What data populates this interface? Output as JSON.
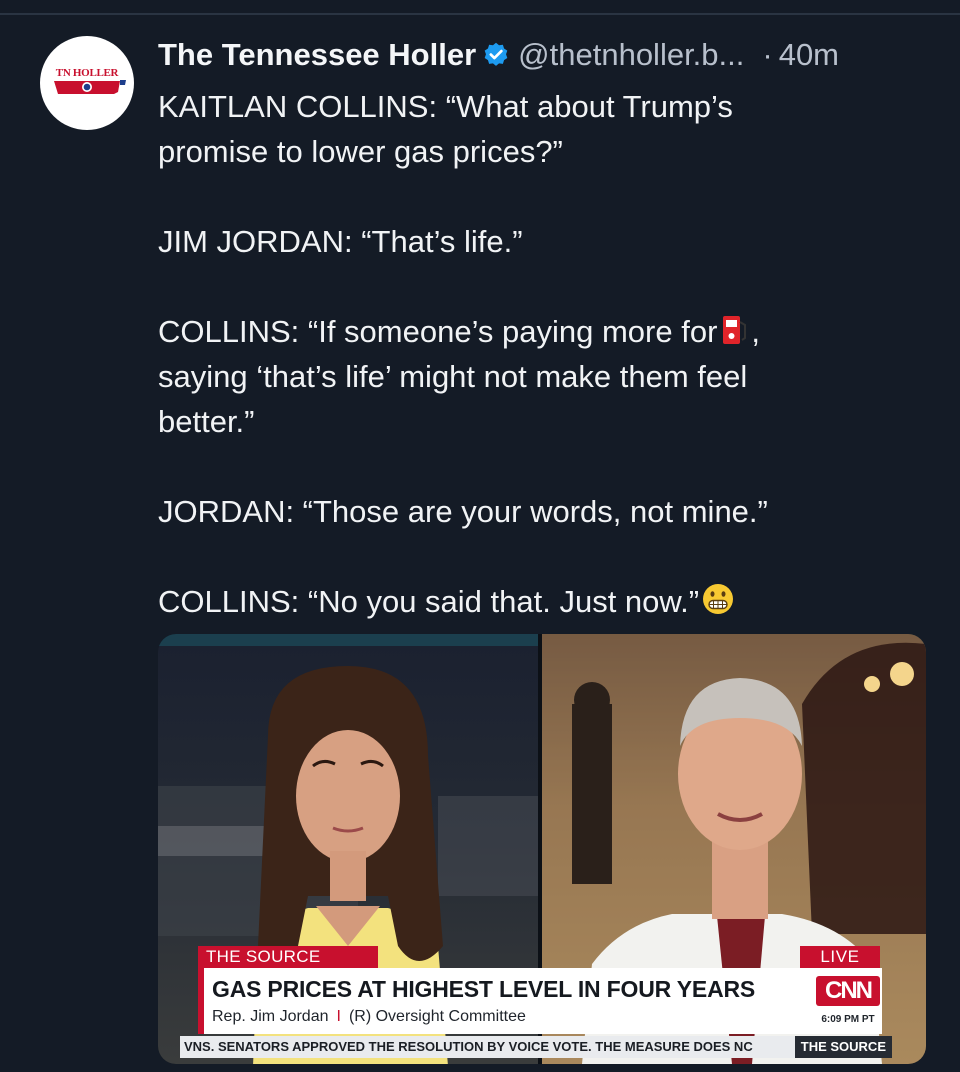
{
  "post": {
    "avatar_text": "TN HOLLER",
    "display_name": "The Tennessee Holler",
    "handle": "@thetnholler.b...",
    "separator": "·",
    "time": "40m",
    "lines": {
      "l1": "KAITLAN COLLINS: “What about Trump’s",
      "l2": "promise to lower gas prices?”",
      "l3": "JIM JORDAN: “That’s life.”",
      "l4a": "COLLINS: “If someone’s paying more for",
      "l4b": ",",
      "l5": "saying ‘that’s life’ might not make them feel",
      "l6": "better.”",
      "l7": "JORDAN: “Those are your words, not mine.”",
      "l8": "COLLINS: “No you said that. Just now.”"
    },
    "emojis": {
      "fuel": "fuel-pump-emoji",
      "grimace": "grimacing-face-emoji"
    }
  },
  "media": {
    "source_tag": "THE SOURCE",
    "live_tag": "LIVE",
    "headline": "GAS PRICES AT HIGHEST LEVEL IN FOUR YEARS",
    "subline_name": "Rep. Jim Jordan",
    "subline_sep": "I",
    "subline_role": "(R) Oversight Committee",
    "network": "CNN",
    "clock": "6:09 PM PT",
    "ticker": "VNS. SENATORS APPROVED THE RESOLUTION BY VOICE VOTE. THE MEASURE DOES NC",
    "ticker_source": "THE SOURCE"
  },
  "colors": {
    "background": "#141b26",
    "verified": "#1d9bf0",
    "cnn_red": "#c8102e"
  }
}
